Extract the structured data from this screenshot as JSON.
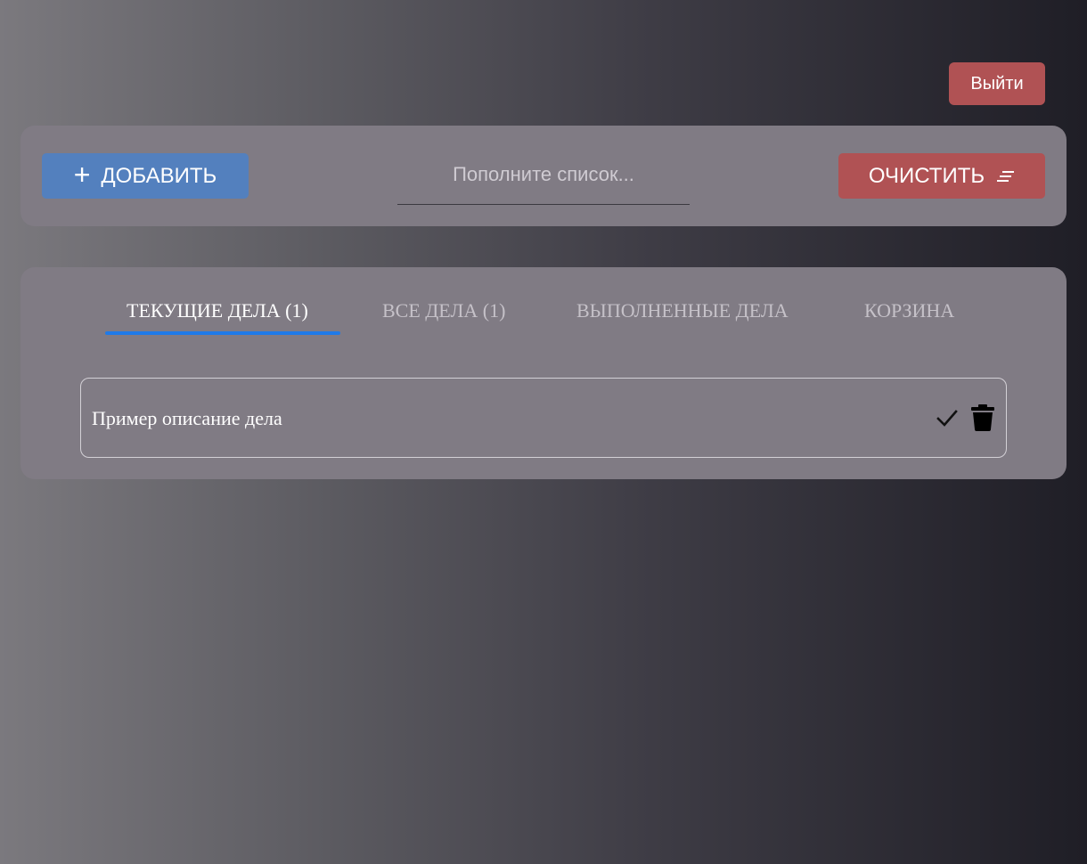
{
  "header": {
    "logout_label": "Выйти"
  },
  "toolbar": {
    "add_label": "ДОБАВИТЬ",
    "add_icon": "plus-icon",
    "search_placeholder": "Пополните список...",
    "search_value": "",
    "clear_label": "ОЧИСТИТЬ",
    "clear_icon": "clear-list-icon"
  },
  "tabs": [
    {
      "label": "ТЕКУЩИЕ ДЕЛА (1)",
      "active": true
    },
    {
      "label": "ВСЕ ДЕЛА (1)",
      "active": false
    },
    {
      "label": "ВЫПОЛНЕННЫЕ ДЕЛА",
      "active": false
    },
    {
      "label": "КОРЗИНА",
      "active": false
    }
  ],
  "tasks": [
    {
      "text": "Пример описание дела",
      "actions": [
        "check-icon",
        "trash-icon"
      ]
    }
  ],
  "colors": {
    "add_button": "#5380be",
    "danger_button": "#b05254",
    "panel": "#807b84",
    "active_tab_indicator": "#1f7ae8"
  }
}
